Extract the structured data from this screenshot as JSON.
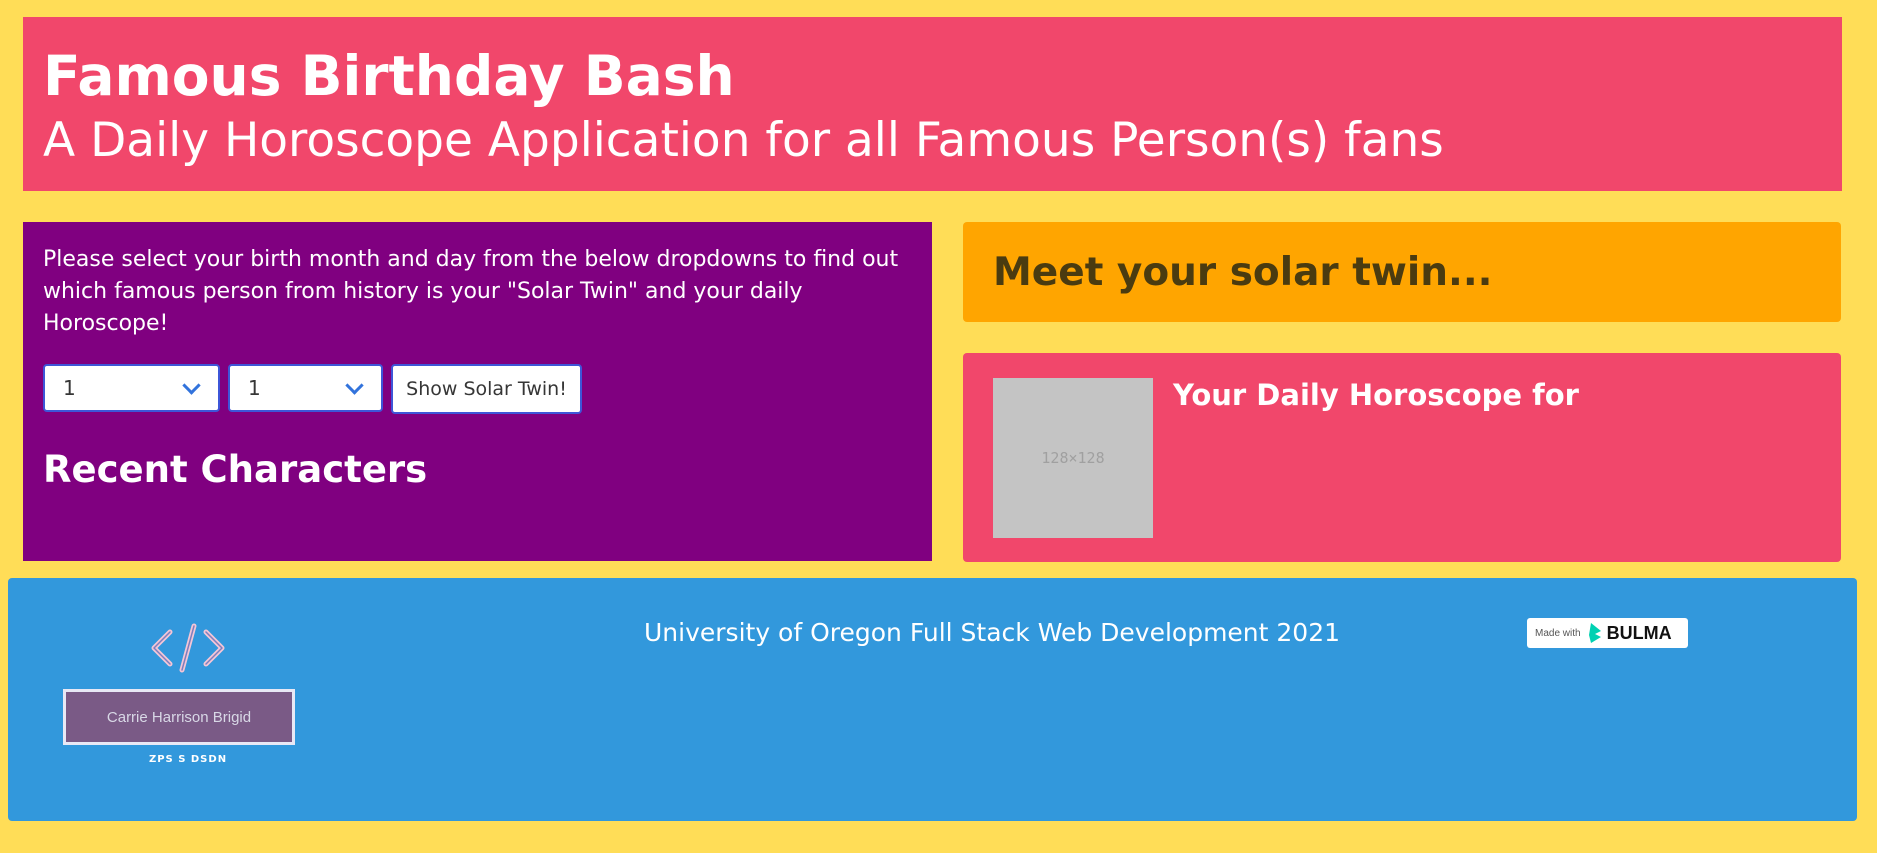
{
  "header": {
    "title": "Famous Birthday Bash",
    "subtitle": "A Daily Horoscope Application for all Famous Person(s) fans"
  },
  "left_panel": {
    "intro": "Please select your birth month and day from the below dropdowns to find out which famous person from history is your \"Solar Twin\" and your daily Horoscope!",
    "month_value": "1",
    "day_value": "1",
    "button_label": "Show Solar Twin!",
    "recent_heading": "Recent Characters"
  },
  "twin_panel": {
    "title": "Meet your solar twin..."
  },
  "horoscope_panel": {
    "title": "Your Daily Horoscope for",
    "placeholder_label": "128×128"
  },
  "footer": {
    "text": "University of Oregon Full Stack Web Development 2021",
    "logo_name": "Carrie Harrison Brigid",
    "logo_tagline": "ZPS S DSDN",
    "badge_made_with": "Made with",
    "badge_brand": "BULMA"
  },
  "colors": {
    "background": "#ffdd57",
    "hero": "#f1476b",
    "left_panel": "#800080",
    "twin_panel": "#ffa500",
    "footer": "#3298dc",
    "bulma_green": "#00d1b2"
  }
}
